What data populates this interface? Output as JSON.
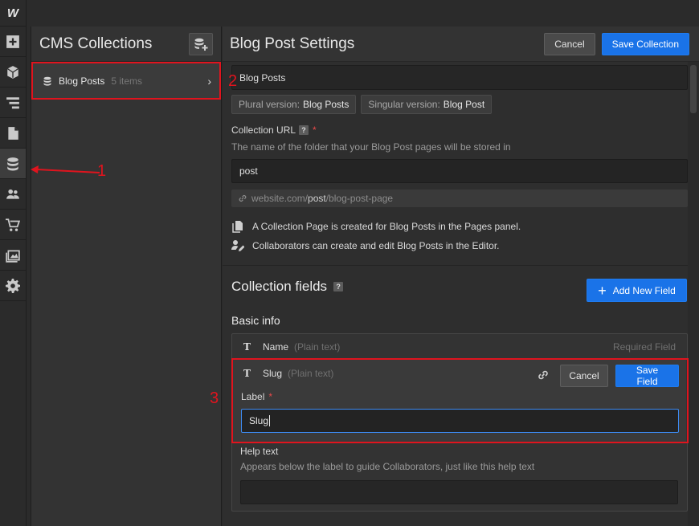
{
  "toolbar": {
    "logo": "W",
    "items": [
      {
        "icon": "add-icon"
      },
      {
        "icon": "cube-icon"
      },
      {
        "icon": "navigator-icon"
      },
      {
        "icon": "pages-icon"
      },
      {
        "icon": "cms-database-icon",
        "active": true
      },
      {
        "icon": "users-icon"
      },
      {
        "icon": "ecommerce-cart-icon"
      },
      {
        "icon": "assets-icon"
      },
      {
        "icon": "settings-gear-icon"
      }
    ]
  },
  "collections": {
    "title": "CMS Collections",
    "items": [
      {
        "name": "Blog Posts",
        "count": "5 items"
      }
    ]
  },
  "settings": {
    "title": "Blog Post Settings",
    "cancel_label": "Cancel",
    "save_label": "Save Collection",
    "name_value": "Blog Posts",
    "plural_label": "Plural version:",
    "plural_value": "Blog Posts",
    "singular_label": "Singular version:",
    "singular_value": "Blog Post",
    "url_label": "Collection URL",
    "url_help": "The name of the folder that your Blog Post pages will be stored in",
    "url_value": "post",
    "url_preview_prefix": "website.com/",
    "url_preview_slug": "post",
    "url_preview_suffix": "/blog-post-page",
    "info_page": "A Collection Page is created for Blog Posts in the Pages panel.",
    "info_collab": "Collaborators can create and edit Blog Posts in the Editor.",
    "fields_title": "Collection fields",
    "add_field_label": "Add New Field",
    "basic_info": "Basic info",
    "fields": [
      {
        "icon": "T",
        "name": "Name",
        "type": "(Plain text)",
        "required": "Required Field"
      },
      {
        "icon": "T",
        "name": "Slug",
        "type": "(Plain text)"
      }
    ],
    "slug_editor": {
      "cancel_label": "Cancel",
      "save_label": "Save Field",
      "label_title": "Label",
      "label_value": "Slug",
      "help_title": "Help text",
      "help_desc": "Appears below the label to guide Collaborators, just like this help text",
      "help_value": ""
    }
  },
  "annotations": [
    "1",
    "2",
    "3"
  ],
  "colors": {
    "accent": "#1a73e8",
    "annotation": "#e0141e"
  }
}
